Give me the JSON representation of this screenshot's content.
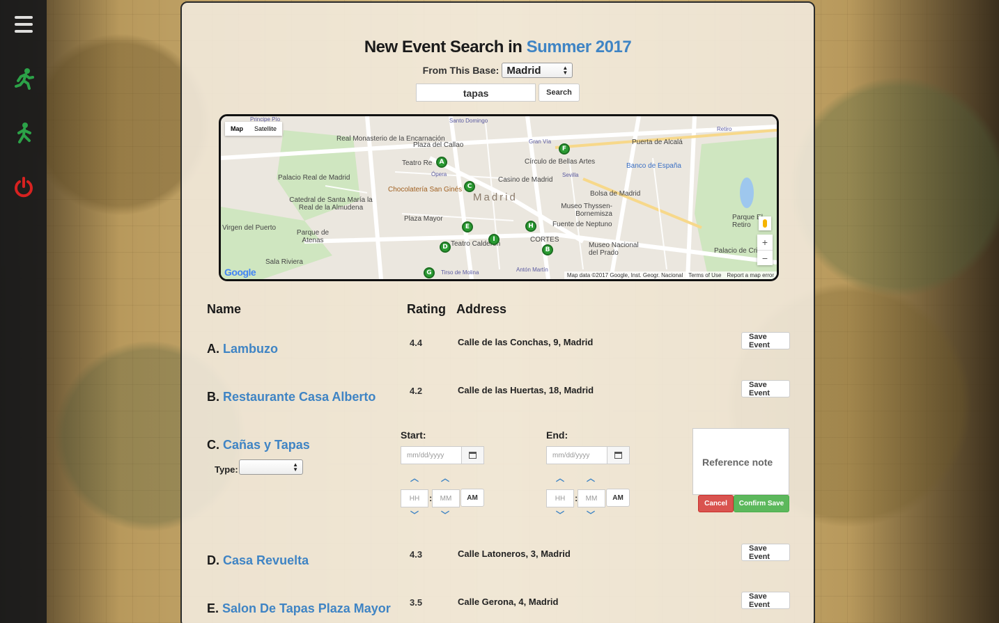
{
  "colors": {
    "accent": "#3f84c4",
    "cancel": "#d9534f",
    "confirm": "#5cb85c",
    "marker": "#2a9b32",
    "icon_walk": "#2aa84a",
    "icon_power": "#e02020"
  },
  "sidebar": {
    "icons": [
      "hamburger-icon",
      "walking-person-icon",
      "walking-person-icon",
      "power-icon"
    ]
  },
  "header": {
    "title_prefix": "New Event Search in",
    "season": "Summer 2017"
  },
  "base": {
    "label": "From This Base:",
    "value": "Madrid"
  },
  "search": {
    "value": "tapas",
    "button": "Search"
  },
  "map": {
    "tabs": {
      "map": "Map",
      "satellite": "Satellite"
    },
    "footer": {
      "data": "Map data ©2017 Google, Inst. Geogr. Nacional",
      "terms": "Terms of Use",
      "report": "Report a map error"
    },
    "logo": "Google",
    "zoom_in": "+",
    "zoom_out": "−",
    "city_label": "Madrid",
    "labels": [
      "Real Monasterio de la Encarnación",
      "Plaza del Callao",
      "Teatro Re",
      "Ópera",
      "Palacio Real de Madrid",
      "Catedral de Santa María la Real de la Almudena",
      "Chocolatería San Ginés",
      "Casino de Madrid",
      "Círculo de Bellas Artes",
      "Banco de España",
      "Puerta de Alcalá",
      "Bolsa de Madrid",
      "Museo Thyssen-Bornemisza",
      "Fuente de Neptuno",
      "Plaza Mayor",
      "Teatro Calderón",
      "CORTES",
      "Museo Nacional del Prado",
      "Virgen del Puerto",
      "Parque de Atenas",
      "Sala Riviera",
      "Palacio de Cristal",
      "Parque El Retiro",
      "Tirso de Molina",
      "Antón Martín",
      "Santo Domingo",
      "Gran Vía",
      "Sevilla",
      "Retiro",
      "Principe Pío"
    ],
    "markers": [
      "A",
      "B",
      "C",
      "D",
      "E",
      "F",
      "G",
      "H",
      "I"
    ]
  },
  "table": {
    "headers": {
      "name": "Name",
      "rating": "Rating",
      "address": "Address"
    },
    "rows": [
      {
        "letter": "A.",
        "name": "Lambuzo",
        "rating": "4.4",
        "address": "Calle de las Conchas, 9, Madrid",
        "button": "Save Event"
      },
      {
        "letter": "B.",
        "name": "Restaurante Casa Alberto",
        "rating": "4.2",
        "address": "Calle de las Huertas, 18, Madrid",
        "button": "Save Event"
      },
      {
        "letter": "C.",
        "name": "Cañas y Tapas"
      },
      {
        "letter": "D.",
        "name": "Casa Revuelta",
        "rating": "4.3",
        "address": "Calle Latoneros, 3, Madrid",
        "button": "Save Event"
      },
      {
        "letter": "E.",
        "name": "Salon De Tapas Plaza Mayor",
        "rating": "3.5",
        "address": "Calle Gerona, 4, Madrid",
        "button": "Save Event"
      }
    ]
  },
  "editor": {
    "type_label": "Type:",
    "start_label": "Start:",
    "end_label": "End:",
    "date_placeholder": "mm/dd/yyyy",
    "hour_placeholder": "HH",
    "minute_placeholder": "MM",
    "ampm": "AM",
    "note_placeholder": "Reference note",
    "cancel": "Cancel",
    "confirm": "Confirm Save"
  }
}
